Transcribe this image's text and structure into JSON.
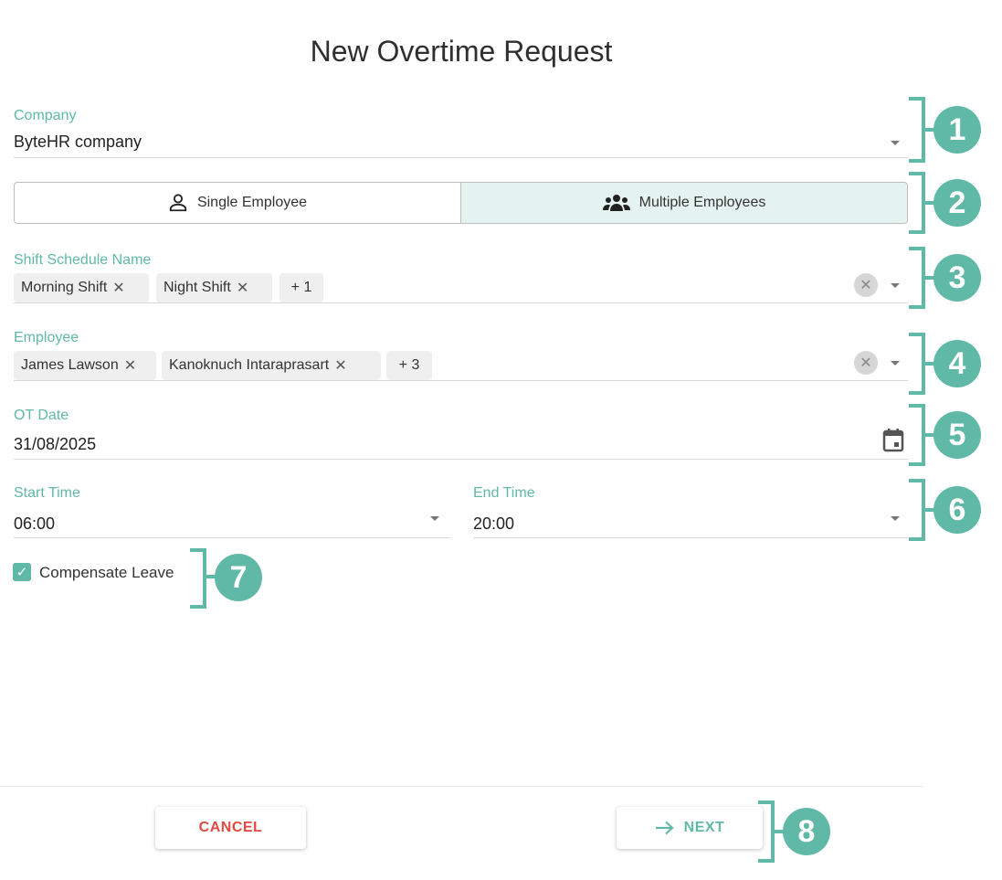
{
  "title": "New Overtime Request",
  "company": {
    "label": "Company",
    "value": "ByteHR company"
  },
  "employee_mode": {
    "single_label": "Single Employee",
    "multiple_label": "Multiple Employees",
    "selected": "multiple"
  },
  "shift_schedule": {
    "label": "Shift Schedule Name",
    "chips": [
      "Morning Shift",
      "Night Shift"
    ],
    "more": "+ 1"
  },
  "employee": {
    "label": "Employee",
    "chips": [
      "James Lawson",
      "Kanoknuch Intaraprasart"
    ],
    "more": "+ 3"
  },
  "ot_date": {
    "label": "OT Date",
    "value": "31/08/2025"
  },
  "start_time": {
    "label": "Start Time",
    "value": "06:00"
  },
  "end_time": {
    "label": "End Time",
    "value": "20:00"
  },
  "compensate_leave": {
    "label": "Compensate Leave",
    "checked": true
  },
  "actions": {
    "cancel": "CANCEL",
    "next": "NEXT"
  },
  "callouts": [
    "1",
    "2",
    "3",
    "4",
    "5",
    "6",
    "7",
    "8"
  ],
  "colors": {
    "accent": "#5fb9a6",
    "cancel": "#e04a3f",
    "toggle_active_bg": "#e4f3ef"
  },
  "icons": {
    "dropdown": "caret-down-icon",
    "clear": "clear-icon",
    "calendar": "calendar-icon",
    "single": "person-icon",
    "multiple": "group-icon",
    "next": "arrow-right-icon",
    "checkbox": "check-icon"
  }
}
